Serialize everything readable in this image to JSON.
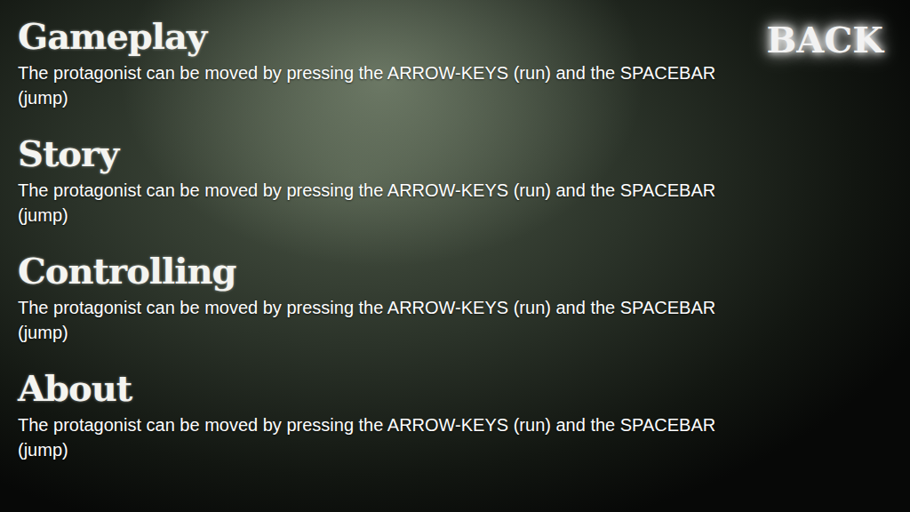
{
  "sections": [
    {
      "heading": "Gameplay",
      "body": "The protagonist can be moved by pressing the ARROW-KEYS (run) and the SPACEBAR (jump)"
    },
    {
      "heading": "Story",
      "body": "The protagonist can be moved by pressing the ARROW-KEYS (run) and the SPACEBAR (jump)"
    },
    {
      "heading": "Controlling",
      "body": "The protagonist can be moved by pressing the ARROW-KEYS (run) and the SPACEBAR (jump)"
    },
    {
      "heading": "About",
      "body": "The protagonist can be moved by pressing the ARROW-KEYS (run) and the SPACEBAR (jump)"
    }
  ],
  "back_button": {
    "label": "BACK"
  }
}
